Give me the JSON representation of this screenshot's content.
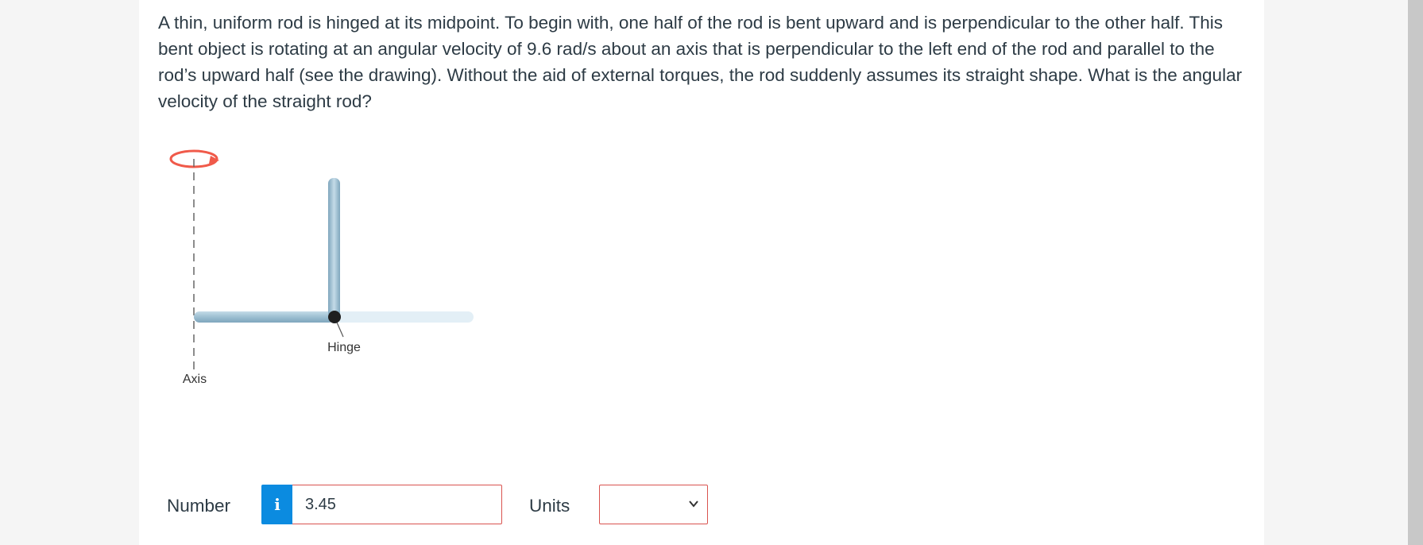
{
  "question": {
    "text": "A thin, uniform rod is hinged at its midpoint. To begin with, one half of the rod is bent upward and is perpendicular to the other half. This bent object is rotating at an angular velocity of 9.6 rad/s about an axis that is perpendicular to the left end of the rod and parallel to the rod’s upward half (see the drawing). Without the aid of external torques, the rod suddenly assumes its straight shape. What is the angular velocity of the straight rod?"
  },
  "diagram": {
    "hinge_label": "Hinge",
    "axis_label": "Axis",
    "colors": {
      "rod": "#9dbfd1",
      "rod_faded": "#e3eff6",
      "rotation_arrow": "#f05a4a",
      "hinge_dot": "#1f1f1f",
      "axis_line": "#666666"
    }
  },
  "answer": {
    "number_label": "Number",
    "info_icon": "info-icon",
    "number_value": "3.45",
    "units_label": "Units",
    "units_selected": "",
    "units_icon": "chevron-down-icon"
  },
  "colors": {
    "text": "#2d3b45",
    "info_button": "#0b8be0",
    "error_border": "#d9534f"
  }
}
